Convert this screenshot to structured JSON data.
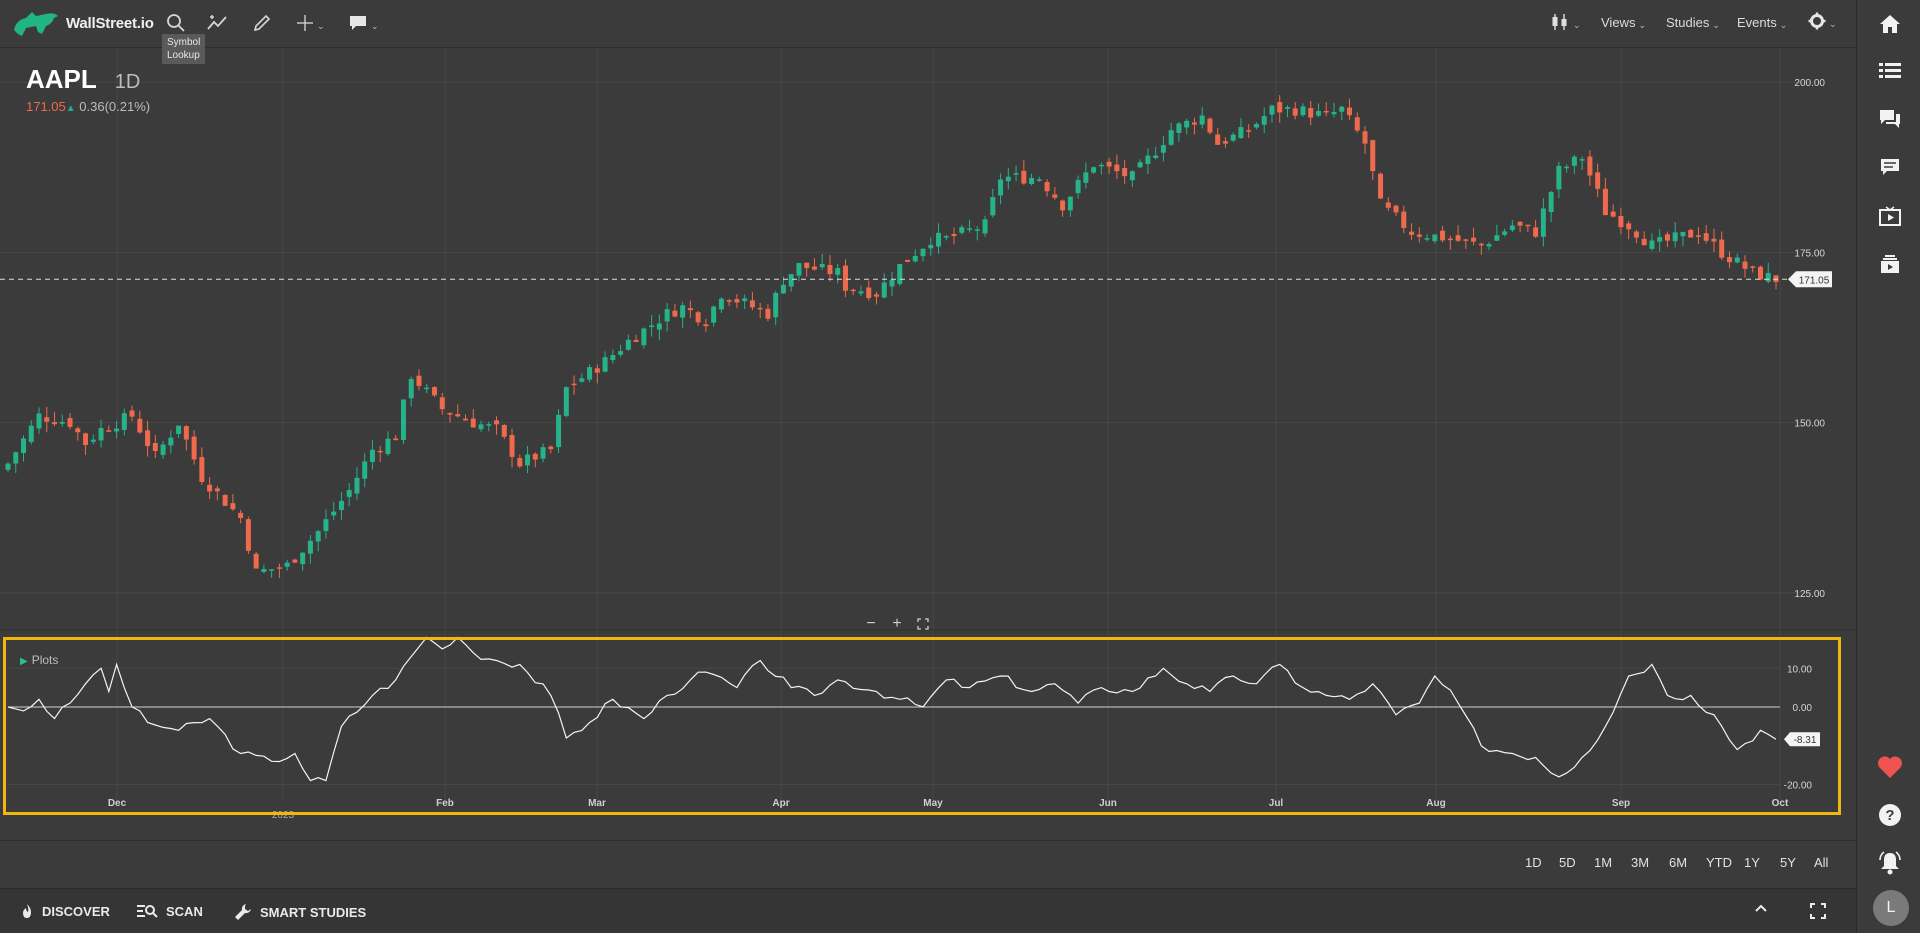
{
  "app": {
    "brand": "WallStreet.io"
  },
  "toolbar": {
    "tooltip_line1": "Symbol",
    "tooltip_line2": "Lookup",
    "views_label": "Views",
    "studies_label": "Studies",
    "events_label": "Events"
  },
  "ticker": {
    "symbol": "AAPL",
    "interval": "1D",
    "last": "171.05",
    "change": "0.36(0.21%)"
  },
  "plots_label": "Plots",
  "range_buttons": [
    "1D",
    "5D",
    "1M",
    "3M",
    "6M",
    "YTD",
    "1Y",
    "5Y",
    "All"
  ],
  "footer": {
    "discover_label": "DISCOVER",
    "scan_label": "SCAN",
    "smart_studies_label": "SMART STUDIES"
  },
  "avatar_initial": "L",
  "colors": {
    "up": "#26b38a",
    "down": "#ef6a4c",
    "background": "#3b3b3b",
    "highlight": "#f2b70f",
    "heart": "#ef5350"
  },
  "chart_data": [
    {
      "type": "candlestick",
      "symbol": "AAPL",
      "interval": "1D",
      "ylim": [
        121,
        204
      ],
      "y_ticks": [
        "125.00",
        "150.00",
        "175.00",
        "200.00"
      ],
      "x_ticks": [
        "Dec",
        "2023",
        "Feb",
        "Mar",
        "Apr",
        "May",
        "Jun",
        "Jul",
        "Aug",
        "Sep",
        "Oct"
      ],
      "last_price": 171.05,
      "last_price_label": "171.05",
      "close_path": [
        [
          0,
          144
        ],
        [
          4,
          151
        ],
        [
          8,
          150
        ],
        [
          10,
          147
        ],
        [
          12,
          149
        ],
        [
          16,
          151
        ],
        [
          19,
          145
        ],
        [
          22,
          150
        ],
        [
          25,
          142
        ],
        [
          30,
          136
        ],
        [
          32,
          128
        ],
        [
          36,
          129
        ],
        [
          40,
          134
        ],
        [
          44,
          140
        ],
        [
          47,
          146
        ],
        [
          50,
          148
        ],
        [
          52,
          157
        ],
        [
          56,
          152
        ],
        [
          60,
          150
        ],
        [
          63,
          149
        ],
        [
          66,
          144
        ],
        [
          70,
          146
        ],
        [
          72,
          155
        ],
        [
          77,
          159
        ],
        [
          80,
          162
        ],
        [
          85,
          166
        ],
        [
          87,
          167
        ],
        [
          90,
          165
        ],
        [
          92,
          169
        ],
        [
          98,
          166
        ],
        [
          100,
          171
        ],
        [
          102,
          173
        ],
        [
          107,
          172
        ],
        [
          108,
          170
        ],
        [
          112,
          169
        ],
        [
          115,
          173
        ],
        [
          119,
          177
        ],
        [
          121,
          177
        ],
        [
          126,
          179
        ],
        [
          128,
          186
        ],
        [
          133,
          186
        ],
        [
          136,
          182
        ],
        [
          140,
          188
        ],
        [
          145,
          186
        ],
        [
          148,
          190
        ],
        [
          150,
          193
        ],
        [
          154,
          195
        ],
        [
          156,
          191
        ],
        [
          160,
          193
        ],
        [
          163,
          196
        ],
        [
          166,
          196
        ],
        [
          170,
          195
        ],
        [
          172,
          196
        ],
        [
          175,
          191
        ],
        [
          177,
          182
        ],
        [
          181,
          178
        ],
        [
          186,
          177
        ],
        [
          190,
          176
        ],
        [
          194,
          179
        ],
        [
          197,
          178
        ],
        [
          200,
          187
        ],
        [
          203,
          189
        ],
        [
          206,
          181
        ],
        [
          209,
          179
        ],
        [
          212,
          176
        ],
        [
          218,
          178
        ],
        [
          221,
          175
        ],
        [
          225,
          172
        ],
        [
          228,
          171.05
        ]
      ]
    },
    {
      "type": "line",
      "series": [
        {
          "name": "Plots",
          "points": [
            [
              0,
              0
            ],
            [
              2,
              -1
            ],
            [
              4,
              2
            ],
            [
              6,
              -3
            ],
            [
              8,
              1
            ],
            [
              10,
              6
            ],
            [
              12,
              10
            ],
            [
              13,
              4
            ],
            [
              14,
              11
            ],
            [
              16,
              0
            ],
            [
              18,
              -4
            ],
            [
              22,
              -6
            ],
            [
              26,
              -3
            ],
            [
              30,
              -12
            ],
            [
              34,
              -14
            ],
            [
              37,
              -12
            ],
            [
              39,
              -19
            ],
            [
              41,
              -19
            ],
            [
              43,
              -5
            ],
            [
              47,
              3
            ],
            [
              50,
              7
            ],
            [
              52,
              13
            ],
            [
              54,
              18
            ],
            [
              56,
              15
            ],
            [
              58,
              18
            ],
            [
              60,
              14
            ],
            [
              63,
              12
            ],
            [
              66,
              11
            ],
            [
              70,
              3
            ],
            [
              72,
              -8
            ],
            [
              75,
              -4
            ],
            [
              78,
              2
            ],
            [
              82,
              -3
            ],
            [
              85,
              3
            ],
            [
              88,
              7
            ],
            [
              90,
              9
            ],
            [
              94,
              5
            ],
            [
              97,
              12
            ],
            [
              101,
              5
            ],
            [
              104,
              3
            ],
            [
              107,
              7
            ],
            [
              112,
              4
            ],
            [
              115,
              2
            ],
            [
              118,
              0
            ],
            [
              121,
              7
            ],
            [
              124,
              5
            ],
            [
              128,
              8
            ],
            [
              132,
              4
            ],
            [
              135,
              6
            ],
            [
              138,
              1
            ],
            [
              141,
              5
            ],
            [
              145,
              4
            ],
            [
              149,
              10
            ],
            [
              152,
              6
            ],
            [
              155,
              4
            ],
            [
              158,
              8
            ],
            [
              161,
              6
            ],
            [
              164,
              11
            ],
            [
              167,
              5
            ],
            [
              170,
              3
            ],
            [
              173,
              2
            ],
            [
              176,
              6
            ],
            [
              179,
              -2
            ],
            [
              182,
              1
            ],
            [
              184,
              8
            ],
            [
              187,
              1
            ],
            [
              190,
              -10
            ],
            [
              194,
              -12
            ],
            [
              197,
              -13
            ],
            [
              200,
              -18
            ],
            [
              203,
              -13
            ],
            [
              206,
              -5
            ],
            [
              209,
              8
            ],
            [
              212,
              11
            ],
            [
              214,
              3
            ],
            [
              217,
              3
            ],
            [
              220,
              -2
            ],
            [
              223,
              -11
            ],
            [
              226,
              -6
            ],
            [
              228,
              -8.31
            ]
          ]
        }
      ],
      "ylim": [
        -24,
        16
      ],
      "y_ticks": [
        "10.00",
        "0.00",
        "-20.00"
      ],
      "last_value_label": "-8.31"
    }
  ]
}
